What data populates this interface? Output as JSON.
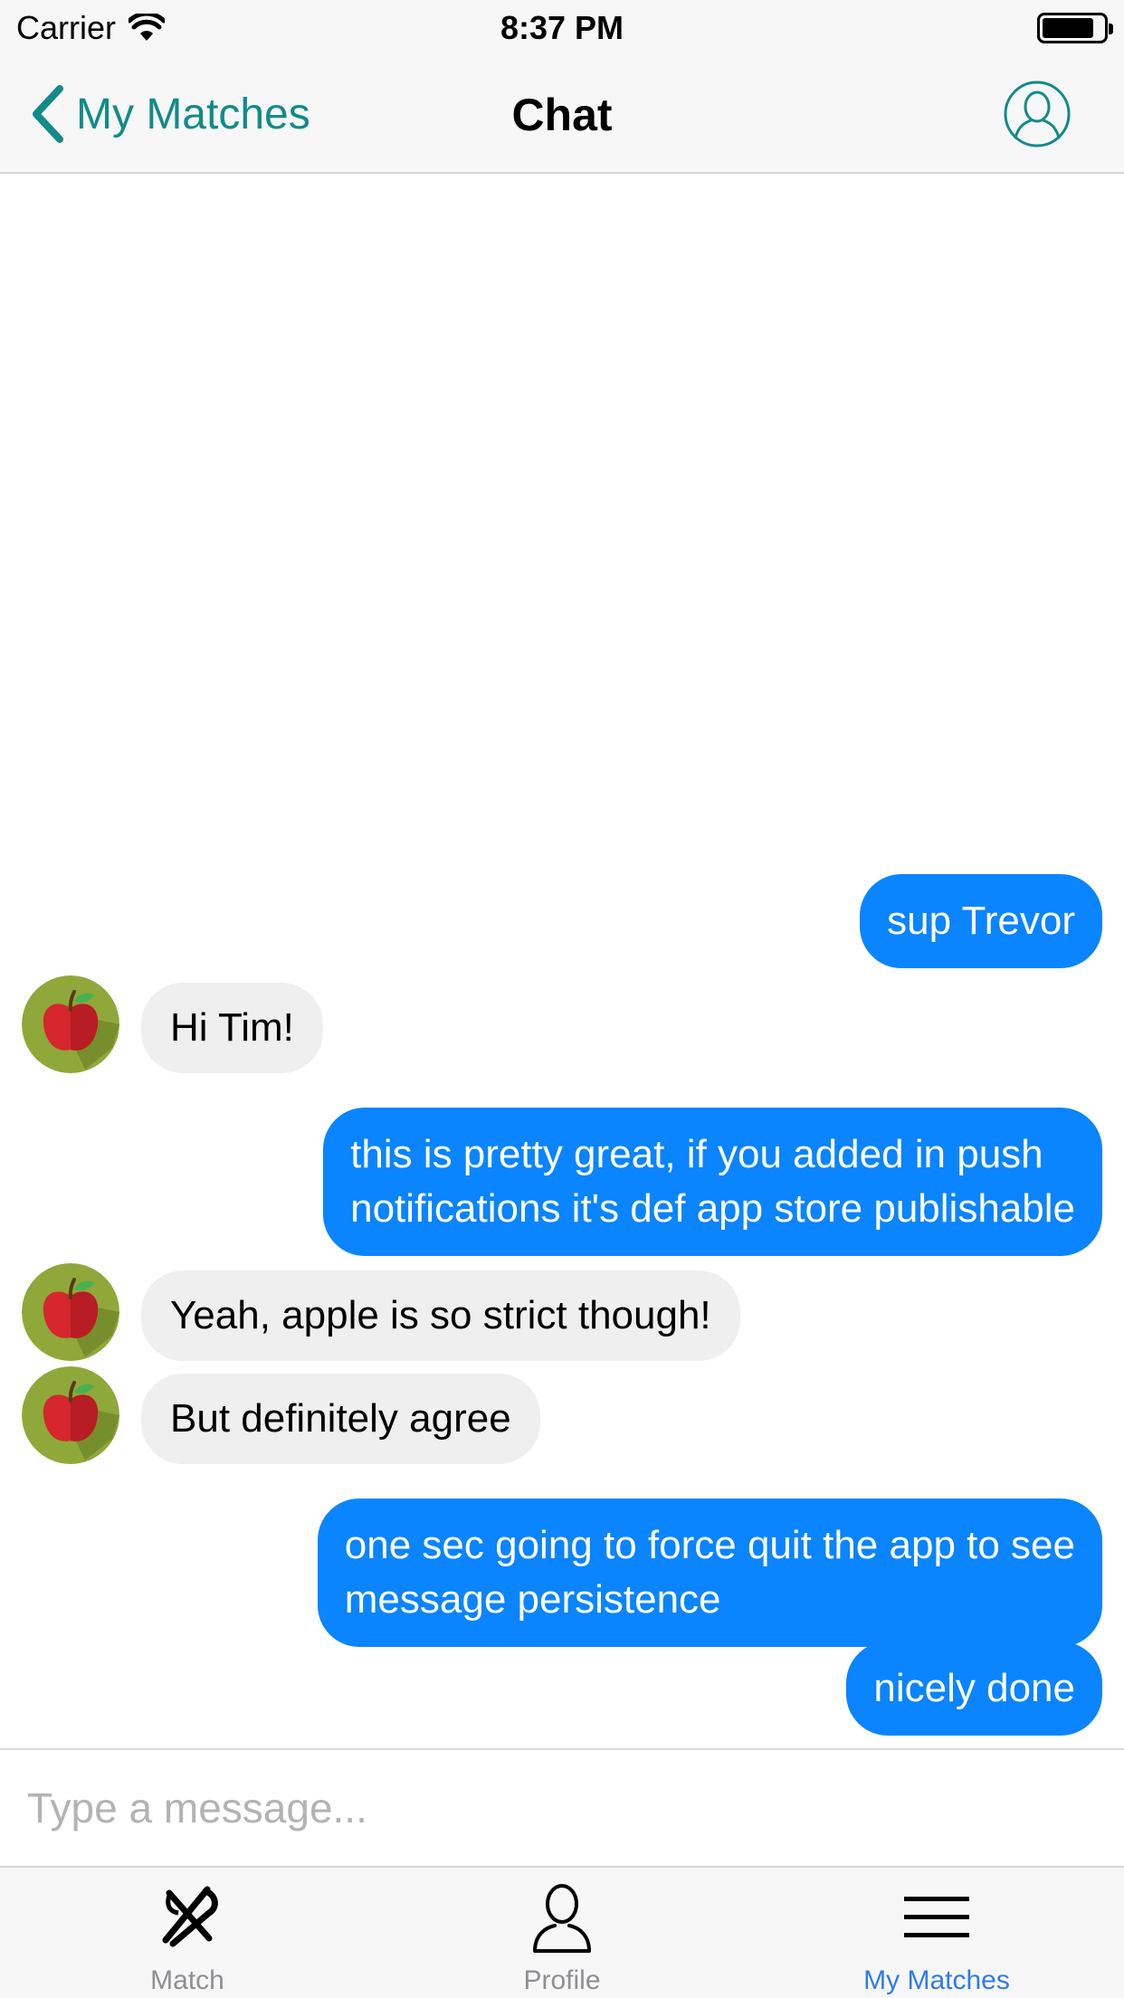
{
  "status_bar": {
    "carrier": "Carrier",
    "time": "8:37 PM",
    "battery_level": 0.85
  },
  "nav": {
    "back_label": "My Matches",
    "title": "Chat",
    "accent_color": "#138a8a",
    "profile_icon": "user-circle-icon"
  },
  "messages": [
    {
      "direction": "outgoing",
      "text": "sup Trevor"
    },
    {
      "direction": "incoming",
      "text": "Hi Tim!",
      "avatar": "apple-avatar"
    },
    {
      "direction": "outgoing",
      "text": "this is pretty great,  if you added in push\nnotifications it's def app store publishable"
    },
    {
      "direction": "incoming",
      "text": "Yeah, apple is so strict though!",
      "avatar": "apple-avatar"
    },
    {
      "direction": "incoming",
      "text": "But definitely agree",
      "avatar": "apple-avatar"
    },
    {
      "direction": "outgoing",
      "text": "one sec going to force quit the app to see\nmessage persistence"
    },
    {
      "direction": "outgoing",
      "text": "nicely done"
    }
  ],
  "composer": {
    "placeholder": "Type a message...",
    "value": ""
  },
  "tabs": [
    {
      "label": "Match",
      "icon": "fork-knife-icon",
      "active": false
    },
    {
      "label": "Profile",
      "icon": "person-icon",
      "active": false
    },
    {
      "label": "My Matches",
      "icon": "list-icon",
      "active": true
    }
  ],
  "colors": {
    "outgoing_bubble": "#0a84ff",
    "incoming_bubble": "#efefef",
    "active_tab": "#2f7bea",
    "inactive_tab": "#8e8e93"
  }
}
